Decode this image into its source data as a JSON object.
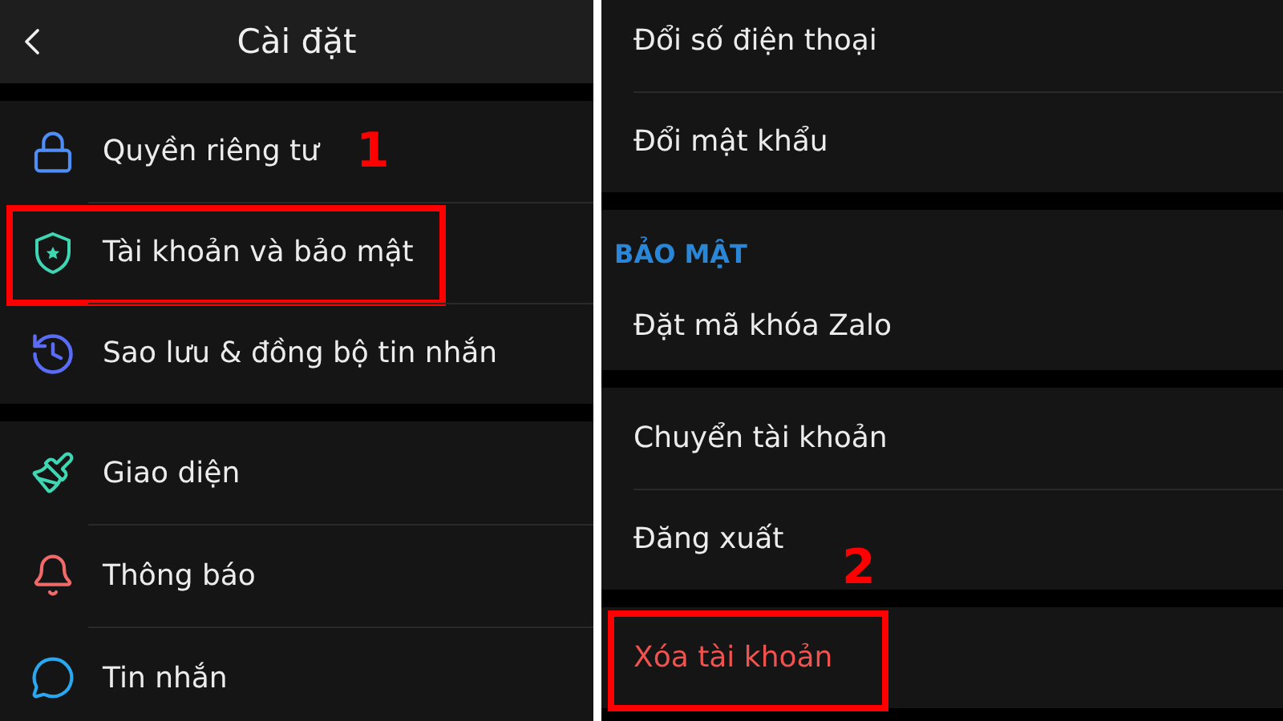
{
  "left_screen": {
    "title": "Cài đặt",
    "groups": [
      {
        "items": [
          {
            "label": "Quyền riêng tư",
            "highlighted": false,
            "marker": "1"
          },
          {
            "label": "Tài khoản và bảo mật",
            "highlighted": true
          },
          {
            "label": "Sao lưu & đồng bộ tin nhắn",
            "highlighted": false
          }
        ]
      },
      {
        "items": [
          {
            "label": "Giao diện",
            "highlighted": false
          },
          {
            "label": "Thông báo",
            "highlighted": false
          },
          {
            "label": "Tin nhắn",
            "highlighted": false
          }
        ]
      }
    ]
  },
  "right_screen": {
    "groups": [
      {
        "items": [
          {
            "label": "Đổi số điện thoại",
            "kind": "normal",
            "highlighted": false
          },
          {
            "label": "Đổi mật khẩu",
            "kind": "normal",
            "highlighted": false
          }
        ]
      },
      {
        "title": "BẢO MẬT",
        "items": [
          {
            "label": "Đặt mã khóa Zalo",
            "kind": "normal",
            "highlighted": false
          }
        ]
      },
      {
        "items": [
          {
            "label": "Chuyển tài khoản",
            "kind": "normal",
            "highlighted": false
          },
          {
            "label": "Đăng xuất",
            "kind": "normal",
            "highlighted": false,
            "marker": "2"
          }
        ]
      },
      {
        "items": [
          {
            "label": "Xóa tài khoản",
            "kind": "danger",
            "highlighted": true
          }
        ]
      }
    ]
  }
}
